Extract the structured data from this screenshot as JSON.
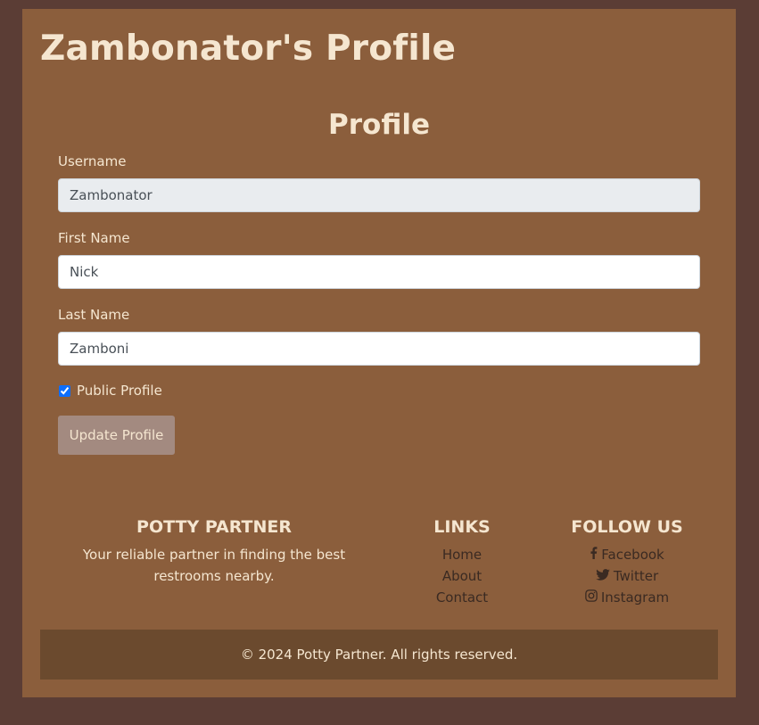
{
  "header": {
    "title": "Zambonator's Profile"
  },
  "form": {
    "title": "Profile",
    "username": {
      "label": "Username",
      "value": "Zambonator"
    },
    "first_name": {
      "label": "First Name",
      "value": "Nick"
    },
    "last_name": {
      "label": "Last Name",
      "value": "Zamboni"
    },
    "public_profile": {
      "label": "Public Profile",
      "checked": true
    },
    "submit_label": "Update Profile"
  },
  "footer": {
    "brand": {
      "heading": "POTTY PARTNER",
      "tagline": "Your reliable partner in finding the best restrooms nearby."
    },
    "links": {
      "heading": "LINKS",
      "items": [
        "Home",
        "About",
        "Contact"
      ]
    },
    "follow": {
      "heading": "FOLLOW US",
      "items": [
        {
          "label": "Facebook",
          "icon": "facebook-icon"
        },
        {
          "label": "Twitter",
          "icon": "twitter-icon"
        },
        {
          "label": "Instagram",
          "icon": "instagram-icon"
        }
      ]
    },
    "copyright": "© 2024 Potty Partner. All rights reserved."
  },
  "colors": {
    "page_bg": "#5b3d35",
    "panel_bg": "#8b5e3c",
    "text_light": "#f5e6d0",
    "button_bg": "#a38a80",
    "footer_bar_bg": "#6b4a2e"
  }
}
